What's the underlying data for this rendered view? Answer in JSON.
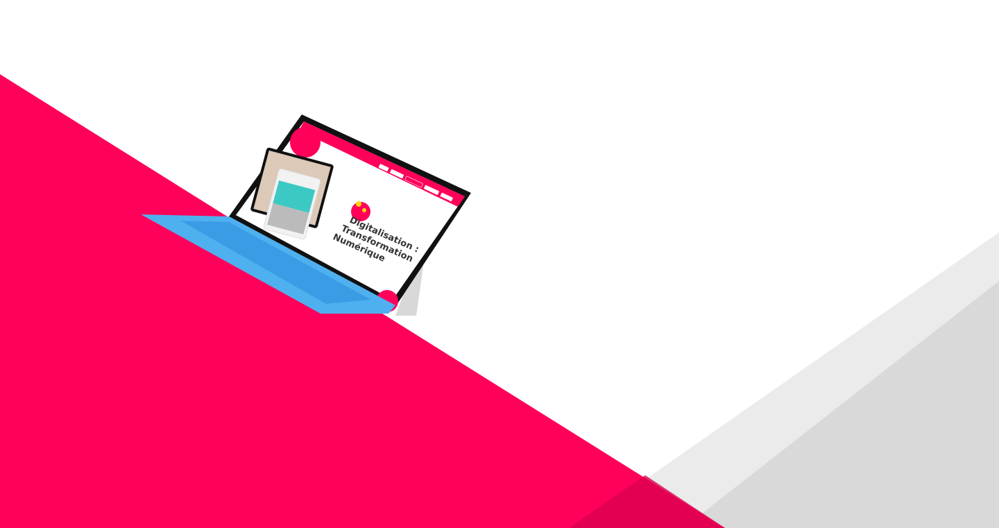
{
  "colors": {
    "brand_pink": "#ff005a",
    "dark_pink": "#dc0050",
    "light_gray": "#ebebeb",
    "mid_gray": "#d9d9d9",
    "keyboard_blue": "#4fb0f0"
  },
  "device_screen": {
    "title_lines": [
      "Digitalisation :",
      "Transformation",
      "Numérique"
    ]
  }
}
